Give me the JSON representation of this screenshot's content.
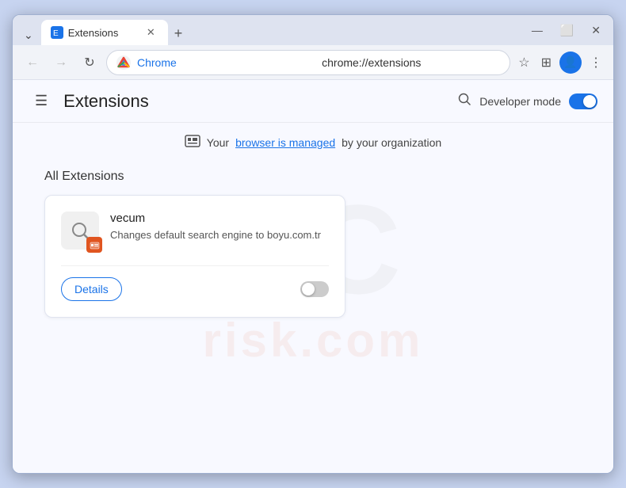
{
  "window": {
    "title": "Extensions",
    "tab_label": "Extensions",
    "close_label": "✕",
    "minimize_label": "—",
    "maximize_label": "⬜",
    "new_tab_label": "+"
  },
  "nav": {
    "back_label": "←",
    "forward_label": "→",
    "reload_label": "↻",
    "chrome_site": "Chrome",
    "url": "chrome://extensions",
    "bookmark_label": "☆",
    "extension_icon_label": "⊞",
    "profile_label": "👤",
    "menu_label": "⋮"
  },
  "page": {
    "title": "Extensions",
    "hamburger_label": "☰",
    "search_label": "🔍",
    "developer_mode_label": "Developer mode",
    "managed_notice_prefix": "Your ",
    "managed_link_text": "browser is managed",
    "managed_notice_suffix": " by your organization",
    "section_title": "All Extensions"
  },
  "extension": {
    "name": "vecum",
    "description": "Changes default search engine to boyu.com.tr",
    "details_label": "Details",
    "icon_symbol": "🔍",
    "badge_symbol": "⊞",
    "enabled": false
  },
  "watermark": {
    "pc_text": "PC",
    "risk_text": "risk.com"
  },
  "colors": {
    "accent": "#1a73e8",
    "toggle_on": "#1a73e8",
    "toggle_off": "#cccccc",
    "badge_bg": "#e05520"
  }
}
